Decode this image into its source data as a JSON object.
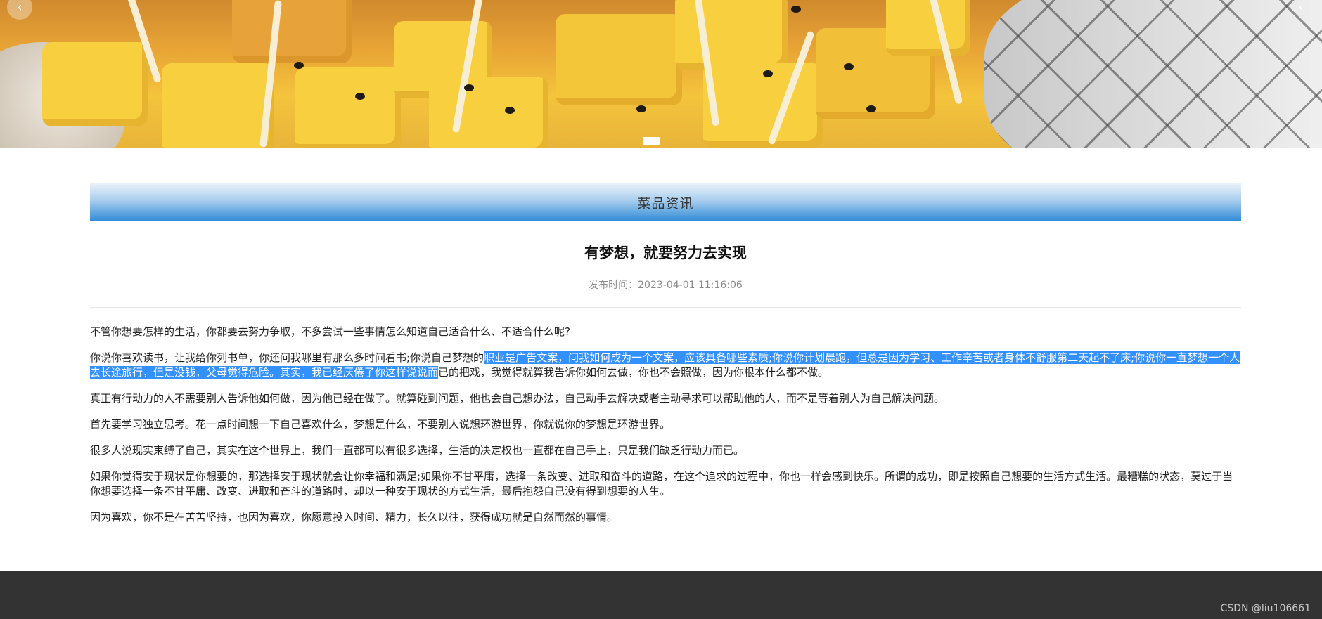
{
  "carousel": {
    "prev_icon": "‹",
    "next_icon": "‹"
  },
  "section": {
    "title": "菜品资讯"
  },
  "article": {
    "title": "有梦想，就要努力去实现",
    "publish_label": "发布时间",
    "publish_time": "2023-04-01 11:16:06",
    "paragraphs": {
      "p1": "不管你想要怎样的生活，你都要去努力争取，不多尝试一些事情怎么知道自己适合什么、不适合什么呢?",
      "p2_before": "你说你喜欢读书，让我给你列书单，你还问我哪里有那么多时间看书;你说自己梦想的",
      "p2_selected": "职业是广告文案，问我如何成为一个文案，应该具备哪些素质;你说你计划晨跑，但总是因为学习、工作辛苦或者身体不舒服第二天起不了床;你说你一直梦想一个人去长途旅行，但是没钱，父母觉得危险。其实，我已经厌倦了你这样说说而",
      "p2_after": "已的把戏，我觉得就算我告诉你如何去做，你也不会照做，因为你根本什么都不做。",
      "p3": "真正有行动力的人不需要别人告诉他如何做，因为他已经在做了。就算碰到问题，他也会自己想办法，自己动手去解决或者主动寻求可以帮助他的人，而不是等着别人为自己解决问题。",
      "p4": "首先要学习独立思考。花一点时间想一下自己喜欢什么，梦想是什么，不要别人说想环游世界，你就说你的梦想是环游世界。",
      "p5": "很多人说现实束缚了自己，其实在这个世界上，我们一直都可以有很多选择，生活的决定权也一直都在自己手上，只是我们缺乏行动力而已。",
      "p6": "如果你觉得安于现状是你想要的，那选择安于现状就会让你幸福和满足;如果你不甘平庸，选择一条改变、进取和奋斗的道路，在这个追求的过程中，你也一样会感到快乐。所谓的成功，即是按照自己想要的生活方式生活。最糟糕的状态，莫过于当你想要选择一条不甘平庸、改变、进取和奋斗的道路时，却以一种安于现状的方式生活，最后抱怨自己没有得到想要的人生。",
      "p7": "因为喜欢，你不是在苦苦坚持，也因为喜欢，你愿意投入时间、精力，长久以往，获得成功就是自然而然的事情。"
    }
  },
  "footer": {
    "watermark": "CSDN @liu106661"
  },
  "colors": {
    "selection": "#3390ff",
    "header_gradient_end": "#2f8ad6",
    "footer_bg": "#333333"
  }
}
